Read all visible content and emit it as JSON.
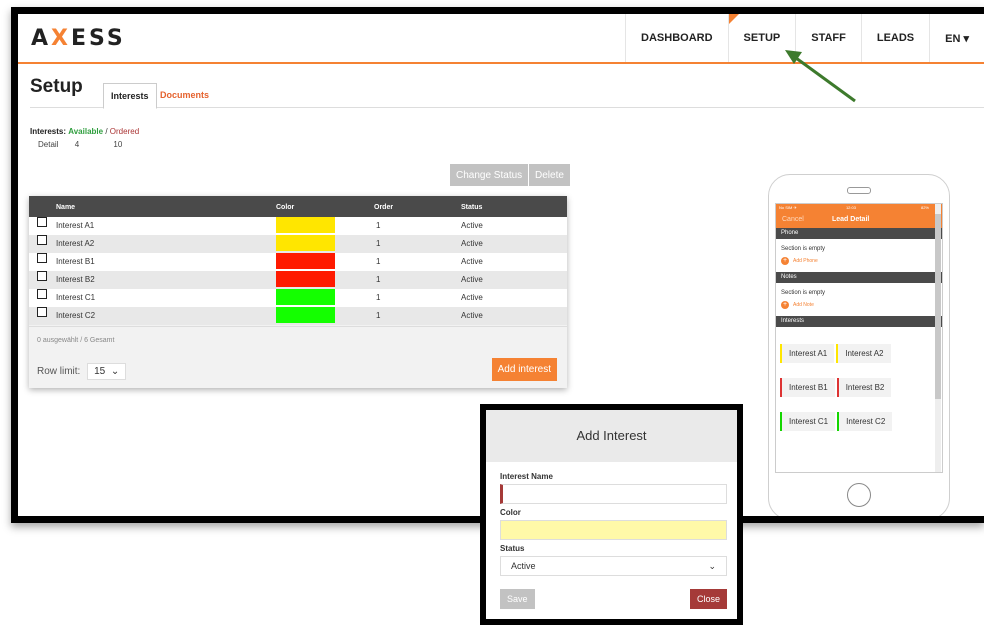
{
  "app": {
    "logo_pre": "A",
    "logo_x": "X",
    "logo_post": "ESS"
  },
  "nav": [
    {
      "label": "DASHBOARD"
    },
    {
      "label": "SETUP"
    },
    {
      "label": "STAFF"
    },
    {
      "label": "LEADS"
    },
    {
      "label": "EN ▾"
    }
  ],
  "page": {
    "title": "Setup",
    "tabs": [
      {
        "label": "Interests"
      },
      {
        "label": "Documents"
      }
    ]
  },
  "stats": {
    "label": "Interests:",
    "available": "Available",
    "sep": "/",
    "ordered": "Ordered",
    "detail": "Detail",
    "available_count": "4",
    "ordered_count": "10"
  },
  "actions": {
    "change_status": "Change Status",
    "delete": "Delete"
  },
  "table": {
    "headers": {
      "name": "Name",
      "color": "Color",
      "order": "Order",
      "status": "Status"
    },
    "rows": [
      {
        "name": "Interest A1",
        "color": "#ffe600",
        "order": "1",
        "status": "Active"
      },
      {
        "name": "Interest A2",
        "color": "#ffe600",
        "order": "1",
        "status": "Active"
      },
      {
        "name": "Interest B1",
        "color": "#ff1a00",
        "order": "1",
        "status": "Active"
      },
      {
        "name": "Interest B2",
        "color": "#ff1a00",
        "order": "1",
        "status": "Active"
      },
      {
        "name": "Interest C1",
        "color": "#14ff00",
        "order": "1",
        "status": "Active"
      },
      {
        "name": "Interest C2",
        "color": "#14ff00",
        "order": "1",
        "status": "Active"
      }
    ],
    "selection_summary": "0 ausgewählt / 6 Gesamt",
    "row_limit_label": "Row limit:",
    "row_limit_value": "15",
    "add_label": "Add interest"
  },
  "phone": {
    "status_left": "No SIM ✈",
    "status_center": "12:03",
    "status_right": "82%",
    "cancel": "Cancel",
    "title": "Lead Detail",
    "sections": [
      {
        "title": "Phone",
        "empty": "Section is empty",
        "add": "Add Phone"
      },
      {
        "title": "Notes",
        "empty": "Section is empty",
        "add": "Add Note"
      }
    ],
    "interests_title": "Interests",
    "chips": [
      {
        "label": "Interest A1",
        "color": "#ffe600"
      },
      {
        "label": "Interest A2",
        "color": "#ffe600"
      },
      {
        "label": "Interest B1",
        "color": "#d33"
      },
      {
        "label": "Interest B2",
        "color": "#d33"
      },
      {
        "label": "Interest C1",
        "color": "#14d600"
      },
      {
        "label": "Interest C2",
        "color": "#14d600"
      }
    ]
  },
  "modal": {
    "title": "Add Interest",
    "name_label": "Interest Name",
    "name_value": "",
    "color_label": "Color",
    "color_value": "#fff9a8",
    "status_label": "Status",
    "status_value": "Active",
    "save": "Save",
    "close": "Close"
  },
  "colors": {
    "accent": "#f58233",
    "arrow": "#3d7a2c",
    "close_btn": "#a53a38"
  }
}
